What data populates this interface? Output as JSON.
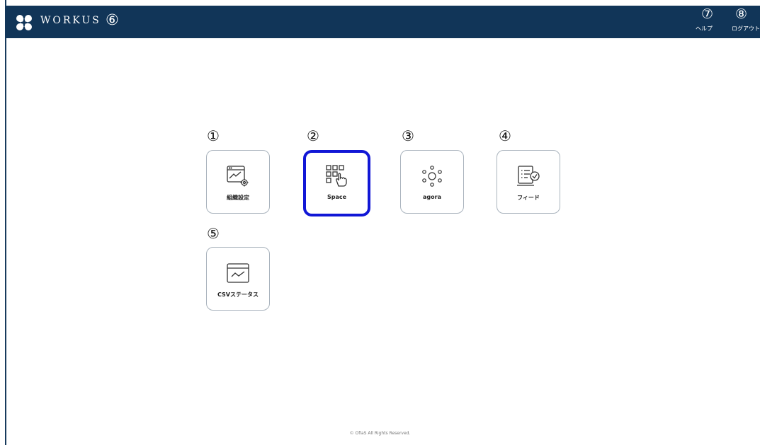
{
  "header": {
    "brand": "WORKUS",
    "annotations": {
      "brand": "⑥",
      "help": "⑦",
      "logout": "⑧"
    },
    "help_label": "ヘルプ",
    "logout_label": "ログアウト"
  },
  "tiles": [
    {
      "annotation": "①",
      "label": "組織設定",
      "icon": "org-settings-icon"
    },
    {
      "annotation": "②",
      "label": "Space",
      "icon": "space-grid-icon",
      "selected": true
    },
    {
      "annotation": "③",
      "label": "agora",
      "icon": "agora-icon"
    },
    {
      "annotation": "④",
      "label": "フィード",
      "icon": "feed-icon"
    },
    {
      "annotation": "⑤",
      "label": "CSVステータス",
      "icon": "csv-status-icon"
    }
  ],
  "footer": {
    "copyright": "© OfiaS All Rights Reserved."
  },
  "colors": {
    "header_bg": "#113558",
    "selected_border": "#1117d6",
    "tile_border": "#a9b3bd"
  }
}
